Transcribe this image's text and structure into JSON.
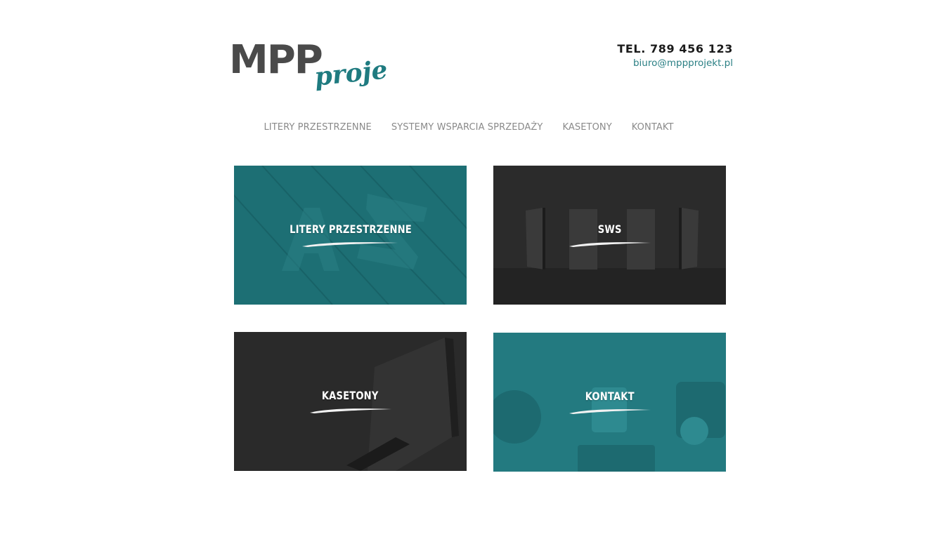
{
  "header": {
    "logo": {
      "main_text": "MPP",
      "script_text": "projekt"
    },
    "phone": "TEL. 789 456 123",
    "email": "biuro@mppprojekt.pl"
  },
  "nav": {
    "items": [
      {
        "label": "LITERY PRZESTRZENNE"
      },
      {
        "label": "SYSTEMY WSPARCIA SPRZEDAŻY"
      },
      {
        "label": "KASETONY"
      },
      {
        "label": "KONTAKT"
      }
    ]
  },
  "tiles": [
    {
      "label": "LITERY PRZESTRZENNE",
      "theme": "teal"
    },
    {
      "label": "SWS",
      "theme": "dark"
    },
    {
      "label": "KASETONY",
      "theme": "dark"
    },
    {
      "label": "KONTAKT",
      "theme": "teal"
    }
  ],
  "colors": {
    "accent": "#2a7f84",
    "teal_tile": "#1f7176",
    "dark_tile": "#2a2a2a",
    "nav_text": "#8a8a8a",
    "phone_text": "#1b1b1b",
    "logo_gray": "#4a4a4a"
  }
}
